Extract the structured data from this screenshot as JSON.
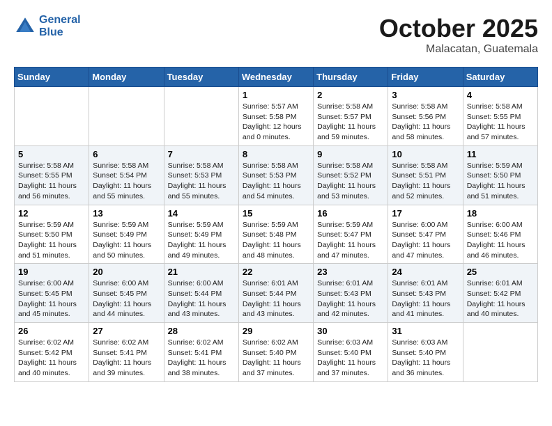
{
  "header": {
    "logo_line1": "General",
    "logo_line2": "Blue",
    "month_title": "October 2025",
    "location": "Malacatan, Guatemala"
  },
  "days_of_week": [
    "Sunday",
    "Monday",
    "Tuesday",
    "Wednesday",
    "Thursday",
    "Friday",
    "Saturday"
  ],
  "weeks": [
    [
      {
        "day": "",
        "sunrise": "",
        "sunset": "",
        "daylight": ""
      },
      {
        "day": "",
        "sunrise": "",
        "sunset": "",
        "daylight": ""
      },
      {
        "day": "",
        "sunrise": "",
        "sunset": "",
        "daylight": ""
      },
      {
        "day": "1",
        "sunrise": "Sunrise: 5:57 AM",
        "sunset": "Sunset: 5:58 PM",
        "daylight": "Daylight: 12 hours and 0 minutes."
      },
      {
        "day": "2",
        "sunrise": "Sunrise: 5:58 AM",
        "sunset": "Sunset: 5:57 PM",
        "daylight": "Daylight: 11 hours and 59 minutes."
      },
      {
        "day": "3",
        "sunrise": "Sunrise: 5:58 AM",
        "sunset": "Sunset: 5:56 PM",
        "daylight": "Daylight: 11 hours and 58 minutes."
      },
      {
        "day": "4",
        "sunrise": "Sunrise: 5:58 AM",
        "sunset": "Sunset: 5:55 PM",
        "daylight": "Daylight: 11 hours and 57 minutes."
      }
    ],
    [
      {
        "day": "5",
        "sunrise": "Sunrise: 5:58 AM",
        "sunset": "Sunset: 5:55 PM",
        "daylight": "Daylight: 11 hours and 56 minutes."
      },
      {
        "day": "6",
        "sunrise": "Sunrise: 5:58 AM",
        "sunset": "Sunset: 5:54 PM",
        "daylight": "Daylight: 11 hours and 55 minutes."
      },
      {
        "day": "7",
        "sunrise": "Sunrise: 5:58 AM",
        "sunset": "Sunset: 5:53 PM",
        "daylight": "Daylight: 11 hours and 55 minutes."
      },
      {
        "day": "8",
        "sunrise": "Sunrise: 5:58 AM",
        "sunset": "Sunset: 5:53 PM",
        "daylight": "Daylight: 11 hours and 54 minutes."
      },
      {
        "day": "9",
        "sunrise": "Sunrise: 5:58 AM",
        "sunset": "Sunset: 5:52 PM",
        "daylight": "Daylight: 11 hours and 53 minutes."
      },
      {
        "day": "10",
        "sunrise": "Sunrise: 5:58 AM",
        "sunset": "Sunset: 5:51 PM",
        "daylight": "Daylight: 11 hours and 52 minutes."
      },
      {
        "day": "11",
        "sunrise": "Sunrise: 5:59 AM",
        "sunset": "Sunset: 5:50 PM",
        "daylight": "Daylight: 11 hours and 51 minutes."
      }
    ],
    [
      {
        "day": "12",
        "sunrise": "Sunrise: 5:59 AM",
        "sunset": "Sunset: 5:50 PM",
        "daylight": "Daylight: 11 hours and 51 minutes."
      },
      {
        "day": "13",
        "sunrise": "Sunrise: 5:59 AM",
        "sunset": "Sunset: 5:49 PM",
        "daylight": "Daylight: 11 hours and 50 minutes."
      },
      {
        "day": "14",
        "sunrise": "Sunrise: 5:59 AM",
        "sunset": "Sunset: 5:49 PM",
        "daylight": "Daylight: 11 hours and 49 minutes."
      },
      {
        "day": "15",
        "sunrise": "Sunrise: 5:59 AM",
        "sunset": "Sunset: 5:48 PM",
        "daylight": "Daylight: 11 hours and 48 minutes."
      },
      {
        "day": "16",
        "sunrise": "Sunrise: 5:59 AM",
        "sunset": "Sunset: 5:47 PM",
        "daylight": "Daylight: 11 hours and 47 minutes."
      },
      {
        "day": "17",
        "sunrise": "Sunrise: 6:00 AM",
        "sunset": "Sunset: 5:47 PM",
        "daylight": "Daylight: 11 hours and 47 minutes."
      },
      {
        "day": "18",
        "sunrise": "Sunrise: 6:00 AM",
        "sunset": "Sunset: 5:46 PM",
        "daylight": "Daylight: 11 hours and 46 minutes."
      }
    ],
    [
      {
        "day": "19",
        "sunrise": "Sunrise: 6:00 AM",
        "sunset": "Sunset: 5:45 PM",
        "daylight": "Daylight: 11 hours and 45 minutes."
      },
      {
        "day": "20",
        "sunrise": "Sunrise: 6:00 AM",
        "sunset": "Sunset: 5:45 PM",
        "daylight": "Daylight: 11 hours and 44 minutes."
      },
      {
        "day": "21",
        "sunrise": "Sunrise: 6:00 AM",
        "sunset": "Sunset: 5:44 PM",
        "daylight": "Daylight: 11 hours and 43 minutes."
      },
      {
        "day": "22",
        "sunrise": "Sunrise: 6:01 AM",
        "sunset": "Sunset: 5:44 PM",
        "daylight": "Daylight: 11 hours and 43 minutes."
      },
      {
        "day": "23",
        "sunrise": "Sunrise: 6:01 AM",
        "sunset": "Sunset: 5:43 PM",
        "daylight": "Daylight: 11 hours and 42 minutes."
      },
      {
        "day": "24",
        "sunrise": "Sunrise: 6:01 AM",
        "sunset": "Sunset: 5:43 PM",
        "daylight": "Daylight: 11 hours and 41 minutes."
      },
      {
        "day": "25",
        "sunrise": "Sunrise: 6:01 AM",
        "sunset": "Sunset: 5:42 PM",
        "daylight": "Daylight: 11 hours and 40 minutes."
      }
    ],
    [
      {
        "day": "26",
        "sunrise": "Sunrise: 6:02 AM",
        "sunset": "Sunset: 5:42 PM",
        "daylight": "Daylight: 11 hours and 40 minutes."
      },
      {
        "day": "27",
        "sunrise": "Sunrise: 6:02 AM",
        "sunset": "Sunset: 5:41 PM",
        "daylight": "Daylight: 11 hours and 39 minutes."
      },
      {
        "day": "28",
        "sunrise": "Sunrise: 6:02 AM",
        "sunset": "Sunset: 5:41 PM",
        "daylight": "Daylight: 11 hours and 38 minutes."
      },
      {
        "day": "29",
        "sunrise": "Sunrise: 6:02 AM",
        "sunset": "Sunset: 5:40 PM",
        "daylight": "Daylight: 11 hours and 37 minutes."
      },
      {
        "day": "30",
        "sunrise": "Sunrise: 6:03 AM",
        "sunset": "Sunset: 5:40 PM",
        "daylight": "Daylight: 11 hours and 37 minutes."
      },
      {
        "day": "31",
        "sunrise": "Sunrise: 6:03 AM",
        "sunset": "Sunset: 5:40 PM",
        "daylight": "Daylight: 11 hours and 36 minutes."
      },
      {
        "day": "",
        "sunrise": "",
        "sunset": "",
        "daylight": ""
      }
    ]
  ]
}
